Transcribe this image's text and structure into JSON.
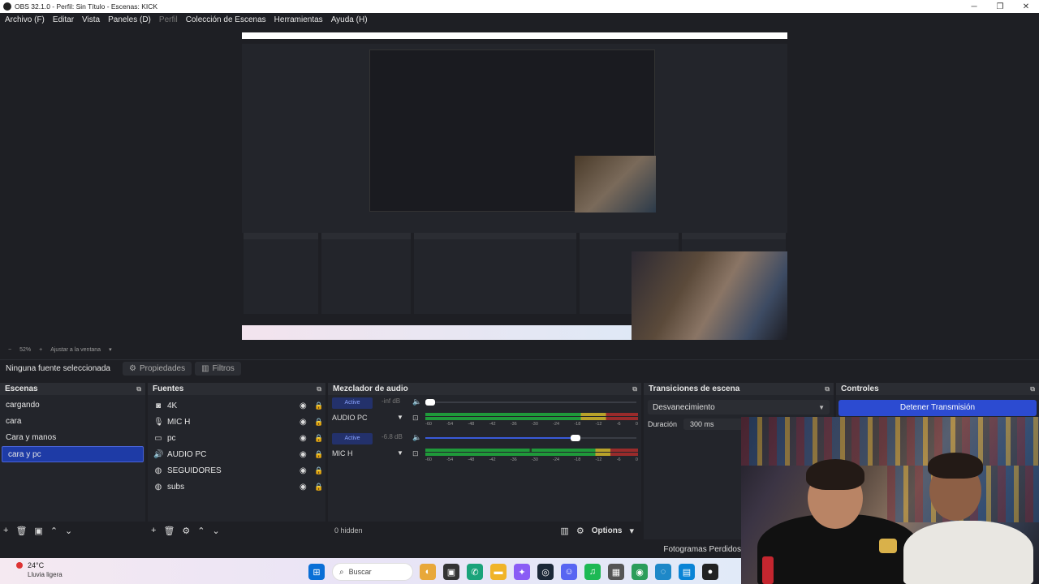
{
  "window": {
    "title": "OBS 32.1.0 - Perfil: Sin Título - Escenas: KICK",
    "buttons": [
      "─",
      "❐",
      "✕"
    ]
  },
  "menu": {
    "items": [
      "Archivo (F)",
      "Editar",
      "Vista",
      "Paneles (D)",
      "Perfil",
      "Colección de Escenas",
      "Herramientas",
      "Ayuda (H)"
    ]
  },
  "zoom": {
    "minus": "−",
    "level": "52%",
    "plus": "+",
    "fit": "Ajustar a la ventana"
  },
  "source_toolbar": {
    "no_selection": "Ninguna fuente seleccionada",
    "properties": "Propiedades",
    "filters": "Filtros"
  },
  "scenes": {
    "title": "Escenas",
    "items": [
      "cargando",
      "cara",
      "Cara y manos",
      "cara y pc"
    ],
    "selected": "cara y pc"
  },
  "sources": {
    "title": "Fuentes",
    "items": [
      {
        "name": "4K",
        "icon": "camera-icon"
      },
      {
        "name": "MIC H",
        "icon": "microphone-icon"
      },
      {
        "name": "pc",
        "icon": "monitor-icon"
      },
      {
        "name": "AUDIO PC",
        "icon": "speaker-icon"
      },
      {
        "name": "SEGUIDORES",
        "icon": "globe-icon"
      },
      {
        "name": "subs",
        "icon": "globe-icon"
      }
    ]
  },
  "mixer": {
    "title": "Mezclador de audio",
    "tracks": [
      {
        "name": "AUDIO PC",
        "badge": "Active",
        "db": "-inf dB",
        "volume": 0.0
      },
      {
        "name": "MIC H",
        "badge": "Active",
        "db": "-6.8 dB",
        "volume": 0.72
      }
    ],
    "ticks": [
      "-60",
      "-54",
      "-48",
      "-42",
      "-36",
      "-30",
      "-24",
      "-18",
      "-12",
      "-6",
      "0"
    ],
    "hidden": "0 hidden",
    "options": "Options"
  },
  "transitions": {
    "title": "Transiciones de escena",
    "selected": "Desvanecimiento",
    "duration_label": "Duración",
    "duration_value": "300 ms"
  },
  "controls": {
    "title": "Controles",
    "stop_stream": "Detener Transmisión"
  },
  "status": {
    "fps_label": "Fotogramas Perdidos"
  },
  "taskbar": {
    "weather_temp": "24°C",
    "weather_desc": "Lluvia ligera",
    "weather_badge": "2",
    "search_placeholder": "Buscar"
  },
  "colors": {
    "accent": "#2c4bd1",
    "selected_scene": "#1e3ba6",
    "meter_green": "#1f9a3a",
    "meter_yellow": "#b9a22a",
    "meter_red": "#9a2b2b"
  }
}
